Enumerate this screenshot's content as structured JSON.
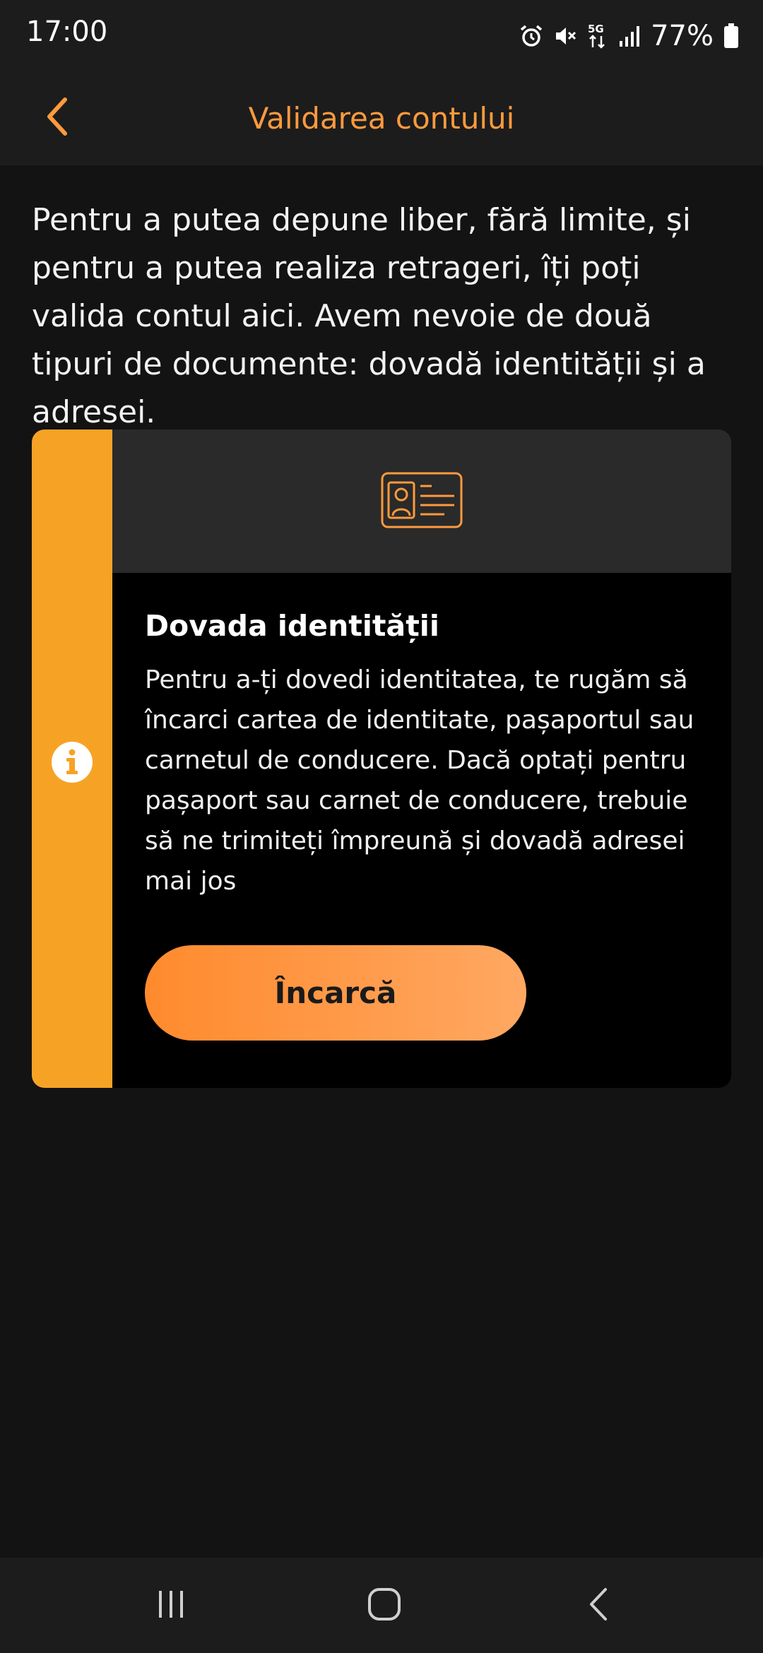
{
  "status_bar": {
    "time": "17:00",
    "battery": "77%",
    "network": "5G",
    "icons": [
      "alarm-icon",
      "mute-icon",
      "network-5g-icon",
      "signal-icon",
      "battery-icon"
    ]
  },
  "app_bar": {
    "title": "Validarea contului",
    "back_icon": "chevron-left-icon"
  },
  "intro": {
    "text": "Pentru a putea depune liber, fără limite, și pentru a putea realiza retrageri, îți poți valida contul aici. Avem nevoie de două tipuri de documente: dovadă identității și a adresei."
  },
  "card": {
    "header_icon": "id-card-icon",
    "status_icon": "info-icon",
    "title": "Dovada identității",
    "text": "Pentru a-ți dovedi identitatea, te rugăm să încarci cartea de identitate, pașaportul sau carnetul de conducere. Dacă optați pentru pașaport sau carnet de conducere, trebuie să ne trimiteți împreună și dovadă adresei mai jos",
    "button_label": "Încarcă"
  },
  "nav_bar": {
    "icons": [
      "recent-apps-icon",
      "home-icon",
      "back-icon"
    ]
  },
  "colors": {
    "accent": "#ff9a3d",
    "stripe": "#f6a325",
    "background": "#131313",
    "card_header": "#2a2a2a",
    "button_gradient_start": "#ff8a2d",
    "button_gradient_end": "#ffa862"
  }
}
